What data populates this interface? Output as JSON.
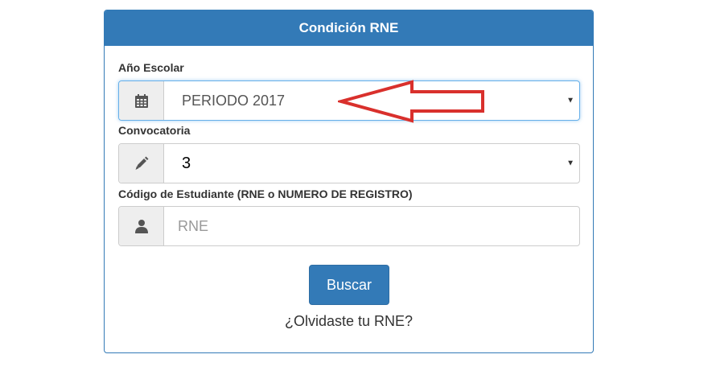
{
  "panel": {
    "title": "Condición RNE"
  },
  "form": {
    "year": {
      "label": "Año Escolar",
      "icon": "calendar-icon",
      "selected": "PERIODO 2017"
    },
    "call": {
      "label": "Convocatoria",
      "icon": "pencil-icon",
      "selected": "3"
    },
    "student_code": {
      "label": "Código de Estudiante (RNE o NUMERO DE REGISTRO)",
      "icon": "user-icon",
      "placeholder": "RNE",
      "value": ""
    },
    "submit_label": "Buscar",
    "forgot_link": "¿Olvidaste tu RNE?",
    "caret": "▼"
  },
  "colors": {
    "primary": "#337ab7",
    "annotation_arrow": "#d9302c"
  }
}
